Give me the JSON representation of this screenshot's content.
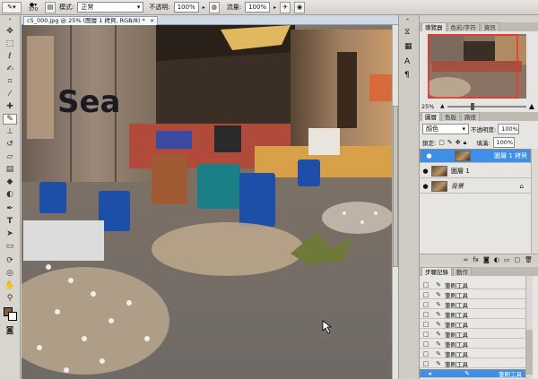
{
  "options_bar": {
    "brush_size": "370",
    "mode_label": "模式:",
    "mode_value": "正常",
    "opacity_label": "不透明:",
    "opacity_value": "100%",
    "flow_label": "流量:",
    "flow_value": "100%"
  },
  "document": {
    "tab_title": "c5_000.jpg @ 25% (图層 1 拷貝, RGB/8) *",
    "tab_close": "×"
  },
  "navigator": {
    "tabs": [
      "導覽器",
      "色彩/字符",
      "資訊"
    ],
    "zoom": "25%"
  },
  "layers": {
    "tabs": [
      "圖層",
      "色版",
      "路徑"
    ],
    "blend_mode": "顏色",
    "opacity_label": "不透明度:",
    "opacity_value": "100%",
    "lock_label": "鎖定:",
    "fill_label": "填滿:",
    "fill_value": "100%",
    "items": [
      {
        "name": "圖層 1 拷貝",
        "selected": true
      },
      {
        "name": "圖層 1",
        "selected": false
      },
      {
        "name": "背景",
        "selected": false
      }
    ],
    "bottom_icons": [
      "link-icon",
      "fx-icon",
      "mask-icon",
      "adjustment-icon",
      "group-icon",
      "new-layer-icon",
      "trash-icon"
    ]
  },
  "history": {
    "tabs": [
      "步驟記錄",
      "動作"
    ],
    "items": [
      "筆刷工具",
      "筆刷工具",
      "筆刷工具",
      "筆刷工具",
      "筆刷工具",
      "筆刷工具",
      "筆刷工具",
      "筆刷工具",
      "筆刷工具",
      "筆刷工具"
    ],
    "selected_index": 9
  },
  "colors": {
    "foreground": "#8a5a3a",
    "background": "#ffffff",
    "accent": "#3d8fe8"
  },
  "photo_text": "Sea"
}
